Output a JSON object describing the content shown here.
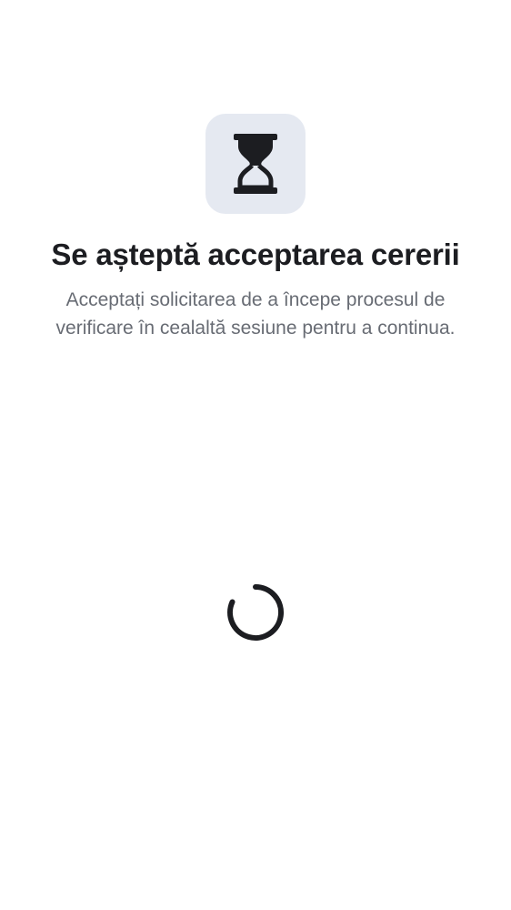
{
  "status": {
    "icon": "hourglass-icon",
    "title": "Se așteptă acceptarea cererii",
    "description": "Acceptați solicitarea de a începe procesul de verificare în cealaltă sesiune pentru a continua.",
    "icon_tile_color": "#e5e9f1",
    "icon_color": "#1c1d21"
  },
  "loading": {
    "indicator": "loading-spinner-icon",
    "color": "#1c1d21"
  }
}
